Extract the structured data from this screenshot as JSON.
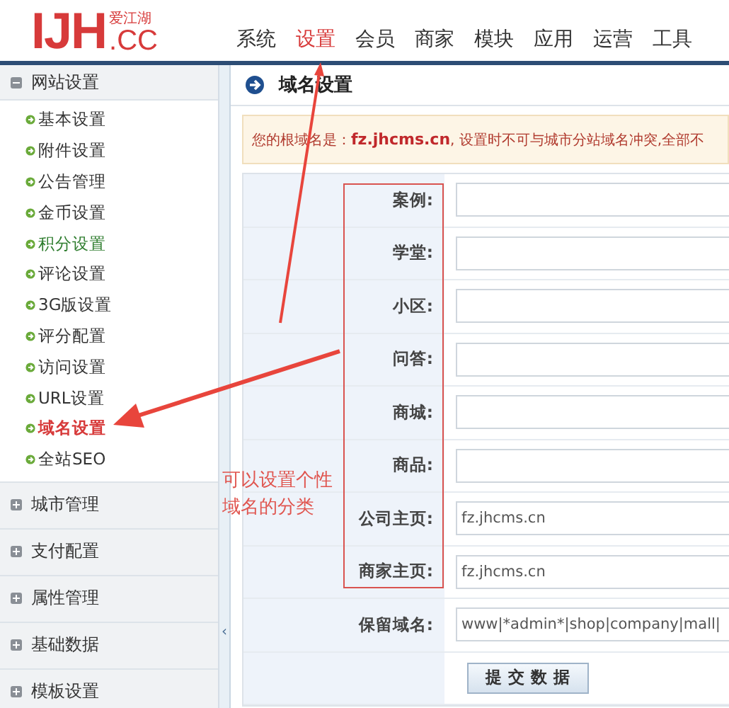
{
  "logo": {
    "mark": "IJH",
    "suffix": ".CC",
    "name": "爱江湖"
  },
  "nav": [
    {
      "label": "系统",
      "selected": false
    },
    {
      "label": "设置",
      "selected": true
    },
    {
      "label": "会员",
      "selected": false
    },
    {
      "label": "商家",
      "selected": false
    },
    {
      "label": "模块",
      "selected": false
    },
    {
      "label": "应用",
      "selected": false
    },
    {
      "label": "运营",
      "selected": false
    },
    {
      "label": "工具",
      "selected": false
    }
  ],
  "sidebar": {
    "groups": [
      {
        "label": "网站设置",
        "expanded": true,
        "items": [
          {
            "label": "基本设置",
            "selected": false,
            "highlighted": false
          },
          {
            "label": "附件设置",
            "selected": false,
            "highlighted": false
          },
          {
            "label": "公告管理",
            "selected": false,
            "highlighted": false
          },
          {
            "label": "金币设置",
            "selected": false,
            "highlighted": false
          },
          {
            "label": "积分设置",
            "selected": false,
            "highlighted": true
          },
          {
            "label": "评论设置",
            "selected": false,
            "highlighted": false
          },
          {
            "label": "3G版设置",
            "selected": false,
            "highlighted": false
          },
          {
            "label": "评分配置",
            "selected": false,
            "highlighted": false
          },
          {
            "label": "访问设置",
            "selected": false,
            "highlighted": false
          },
          {
            "label": "URL设置",
            "selected": false,
            "highlighted": false
          },
          {
            "label": "域名设置",
            "selected": true,
            "highlighted": false
          },
          {
            "label": "全站SEO",
            "selected": false,
            "highlighted": false
          }
        ]
      },
      {
        "label": "城市管理",
        "expanded": false
      },
      {
        "label": "支付配置",
        "expanded": false
      },
      {
        "label": "属性管理",
        "expanded": false
      },
      {
        "label": "基础数据",
        "expanded": false
      },
      {
        "label": "模板设置",
        "expanded": false
      }
    ],
    "collapse_handle": "‹"
  },
  "page": {
    "title": "域名设置",
    "notice": "您的根域名是：**fz.jhcms.cn**, 设置时不可与城市分站域名冲突,全部不",
    "rows": [
      {
        "label": "案例:"
      },
      {
        "label": "学堂:"
      },
      {
        "label": "小区:"
      },
      {
        "label": "问答:"
      },
      {
        "label": "商城:"
      },
      {
        "label": "商品:"
      },
      {
        "label": "公司主页:",
        "value": "fz.jhcms.cn"
      },
      {
        "label": "商家主页:",
        "value": "fz.jhcms.cn"
      },
      {
        "label": "保留域名:",
        "value": "www|*admin*|shop|company|mall|"
      }
    ],
    "submit": "提 交 数 据"
  },
  "annotation": {
    "lines": [
      "可以设置个性",
      "域名的分类"
    ]
  }
}
